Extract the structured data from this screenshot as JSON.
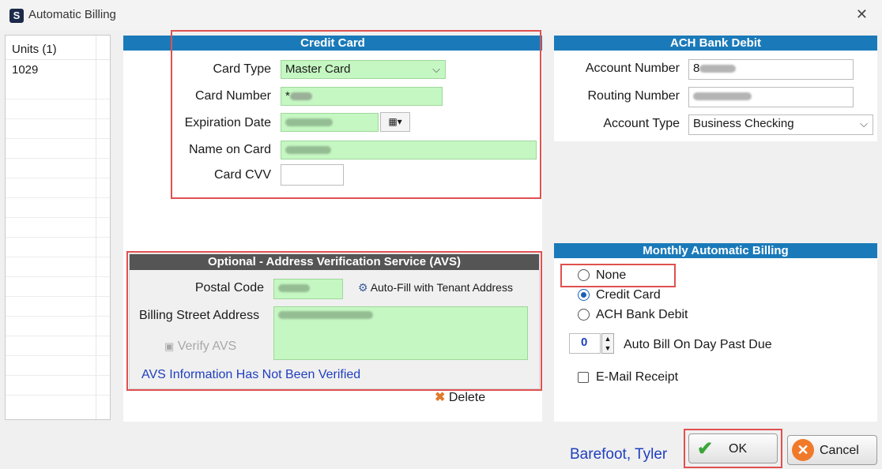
{
  "window": {
    "title": "Automatic Billing",
    "app_icon": "S"
  },
  "units": {
    "header": "Units (1)",
    "items": [
      "1029"
    ]
  },
  "credit_card": {
    "header": "Credit Card",
    "card_type_label": "Card Type",
    "card_type_value": "Master Card",
    "card_number_label": "Card Number",
    "card_number_prefix": "*",
    "expiration_label": "Expiration Date",
    "name_label": "Name on Card",
    "cvv_label": "Card CVV"
  },
  "ach": {
    "header": "ACH Bank Debit",
    "account_number_label": "Account Number",
    "account_number_prefix": "8",
    "routing_number_label": "Routing Number",
    "account_type_label": "Account Type",
    "account_type_value": "Business Checking"
  },
  "avs": {
    "header": "Optional - Address Verification Service (AVS)",
    "postal_code_label": "Postal Code",
    "autofill_label": "Auto-Fill with Tenant Address",
    "street_label": "Billing Street Address",
    "verify_label": "Verify AVS",
    "status_text": "AVS Information Has Not Been Verified"
  },
  "delete_label": "Delete",
  "monthly": {
    "header": "Monthly Automatic Billing",
    "options": [
      "None",
      "Credit Card",
      "ACH Bank Debit"
    ],
    "selected": "Credit Card",
    "day_value": "0",
    "day_label": "Auto Bill On Day Past Due",
    "email_label": "E-Mail Receipt",
    "email_checked": false
  },
  "tenant_name": "Barefoot, Tyler",
  "buttons": {
    "ok": "OK",
    "cancel": "Cancel"
  },
  "colors": {
    "header_blue": "#1a7ab9",
    "field_green": "#c5f7c2",
    "highlight_red": "#e05050",
    "link_blue": "#1f3fbf"
  }
}
